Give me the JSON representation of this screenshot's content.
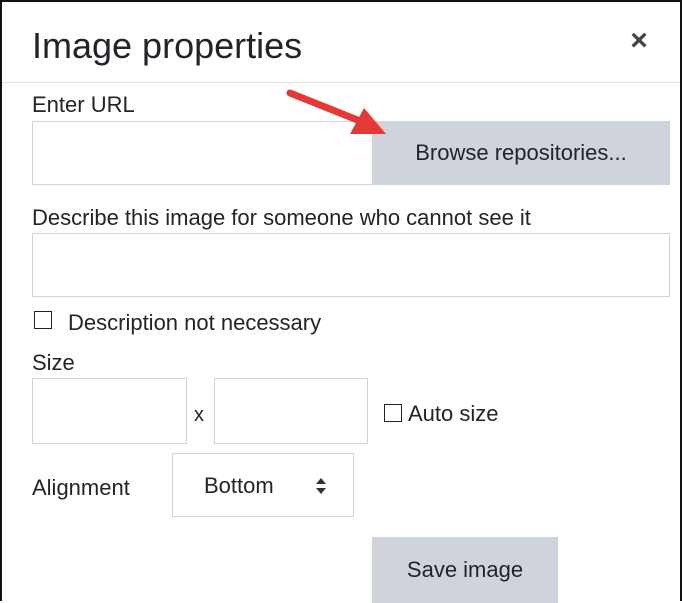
{
  "dialog": {
    "title": "Image properties",
    "close_label": "×"
  },
  "url_section": {
    "label": "Enter URL",
    "value": "",
    "browse_label": "Browse repositories..."
  },
  "description_section": {
    "label": "Describe this image for someone who cannot see it",
    "value": "",
    "not_necessary_label": "Description not necessary",
    "not_necessary_checked": false
  },
  "size_section": {
    "label": "Size",
    "width_value": "",
    "separator": "x",
    "height_value": "",
    "auto_size_label": "Auto size",
    "auto_size_checked": false
  },
  "alignment_section": {
    "label": "Alignment",
    "selected": "Bottom"
  },
  "footer": {
    "save_label": "Save image"
  },
  "annotation": {
    "arrow_color": "#e53935"
  },
  "colors": {
    "button_bg": "#ced4da",
    "input_border": "#ced4da",
    "text": "#212529"
  }
}
